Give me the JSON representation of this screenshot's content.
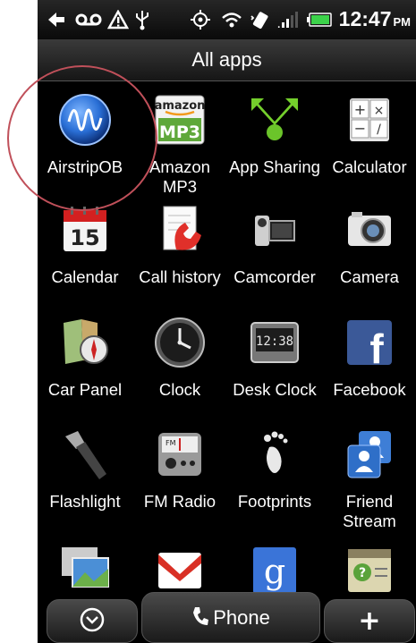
{
  "status_bar": {
    "time": "12:47",
    "ampm": "PM",
    "icons": [
      "notification-arrow-icon",
      "voicemail-icon",
      "warning-icon",
      "usb-icon",
      "gps-icon",
      "wifi-icon",
      "vibrate-icon",
      "signal-icon",
      "battery-icon"
    ]
  },
  "header": {
    "title": "All apps"
  },
  "apps": [
    {
      "label": "AirstripOB",
      "icon": "airstrip-wave-icon"
    },
    {
      "label": "Amazon\nMP3",
      "icon": "amazon-mp3-icon",
      "icon_text_top": "amazon",
      "icon_text_bottom": "MP3"
    },
    {
      "label": "App Sharing",
      "icon": "app-sharing-icon"
    },
    {
      "label": "Calculator",
      "icon": "calculator-icon"
    },
    {
      "label": "Calendar",
      "icon": "calendar-icon",
      "icon_text": "15"
    },
    {
      "label": "Call history",
      "icon": "call-history-icon"
    },
    {
      "label": "Camcorder",
      "icon": "camcorder-icon"
    },
    {
      "label": "Camera",
      "icon": "camera-icon"
    },
    {
      "label": "Car Panel",
      "icon": "car-panel-compass-icon"
    },
    {
      "label": "Clock",
      "icon": "clock-icon"
    },
    {
      "label": "Desk Clock",
      "icon": "desk-clock-icon",
      "icon_text": "12:38"
    },
    {
      "label": "Facebook",
      "icon": "facebook-icon",
      "icon_text": "f"
    },
    {
      "label": "Flashlight",
      "icon": "flashlight-icon"
    },
    {
      "label": "FM Radio",
      "icon": "fm-radio-icon",
      "icon_text": "FM"
    },
    {
      "label": "Footprints",
      "icon": "footprints-icon"
    },
    {
      "label": "Friend\nStream",
      "icon": "friend-stream-icon"
    },
    {
      "label": "",
      "icon": "gallery-icon"
    },
    {
      "label": "",
      "icon": "gmail-icon"
    },
    {
      "label": "",
      "icon": "google-search-icon",
      "icon_text": "g"
    },
    {
      "label": "",
      "icon": "help-notes-icon"
    }
  ],
  "dock": {
    "left_icon": "chevron-down-icon",
    "phone_label": "Phone",
    "phone_icon": "phone-handset-icon",
    "add_label": "+",
    "add_icon": "plus-icon"
  },
  "colors": {
    "annotation_circle": "#c0505a",
    "facebook_blue": "#3b5998",
    "airstrip_blue": "#2a6fd6"
  }
}
